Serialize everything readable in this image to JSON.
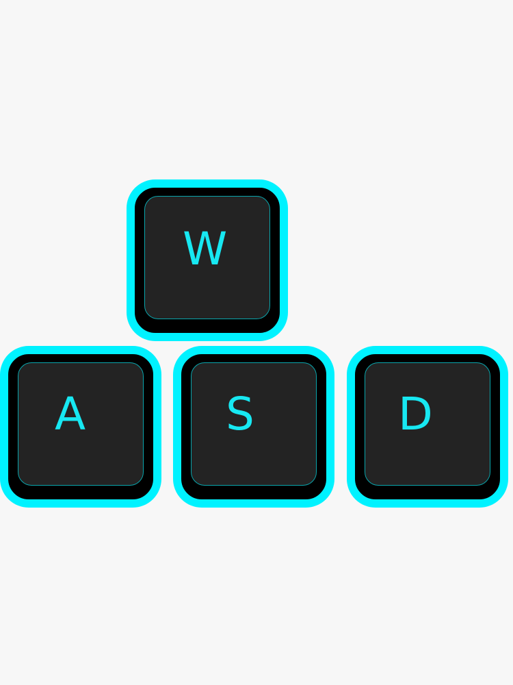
{
  "keys": {
    "w": "W",
    "a": "A",
    "s": "S",
    "d": "D"
  },
  "colors": {
    "background": "#f7f7f7",
    "glow": "#00f2ff",
    "keycap_outer": "#000000",
    "keycap_inner": "#232323",
    "legend": "#17e8f2"
  }
}
